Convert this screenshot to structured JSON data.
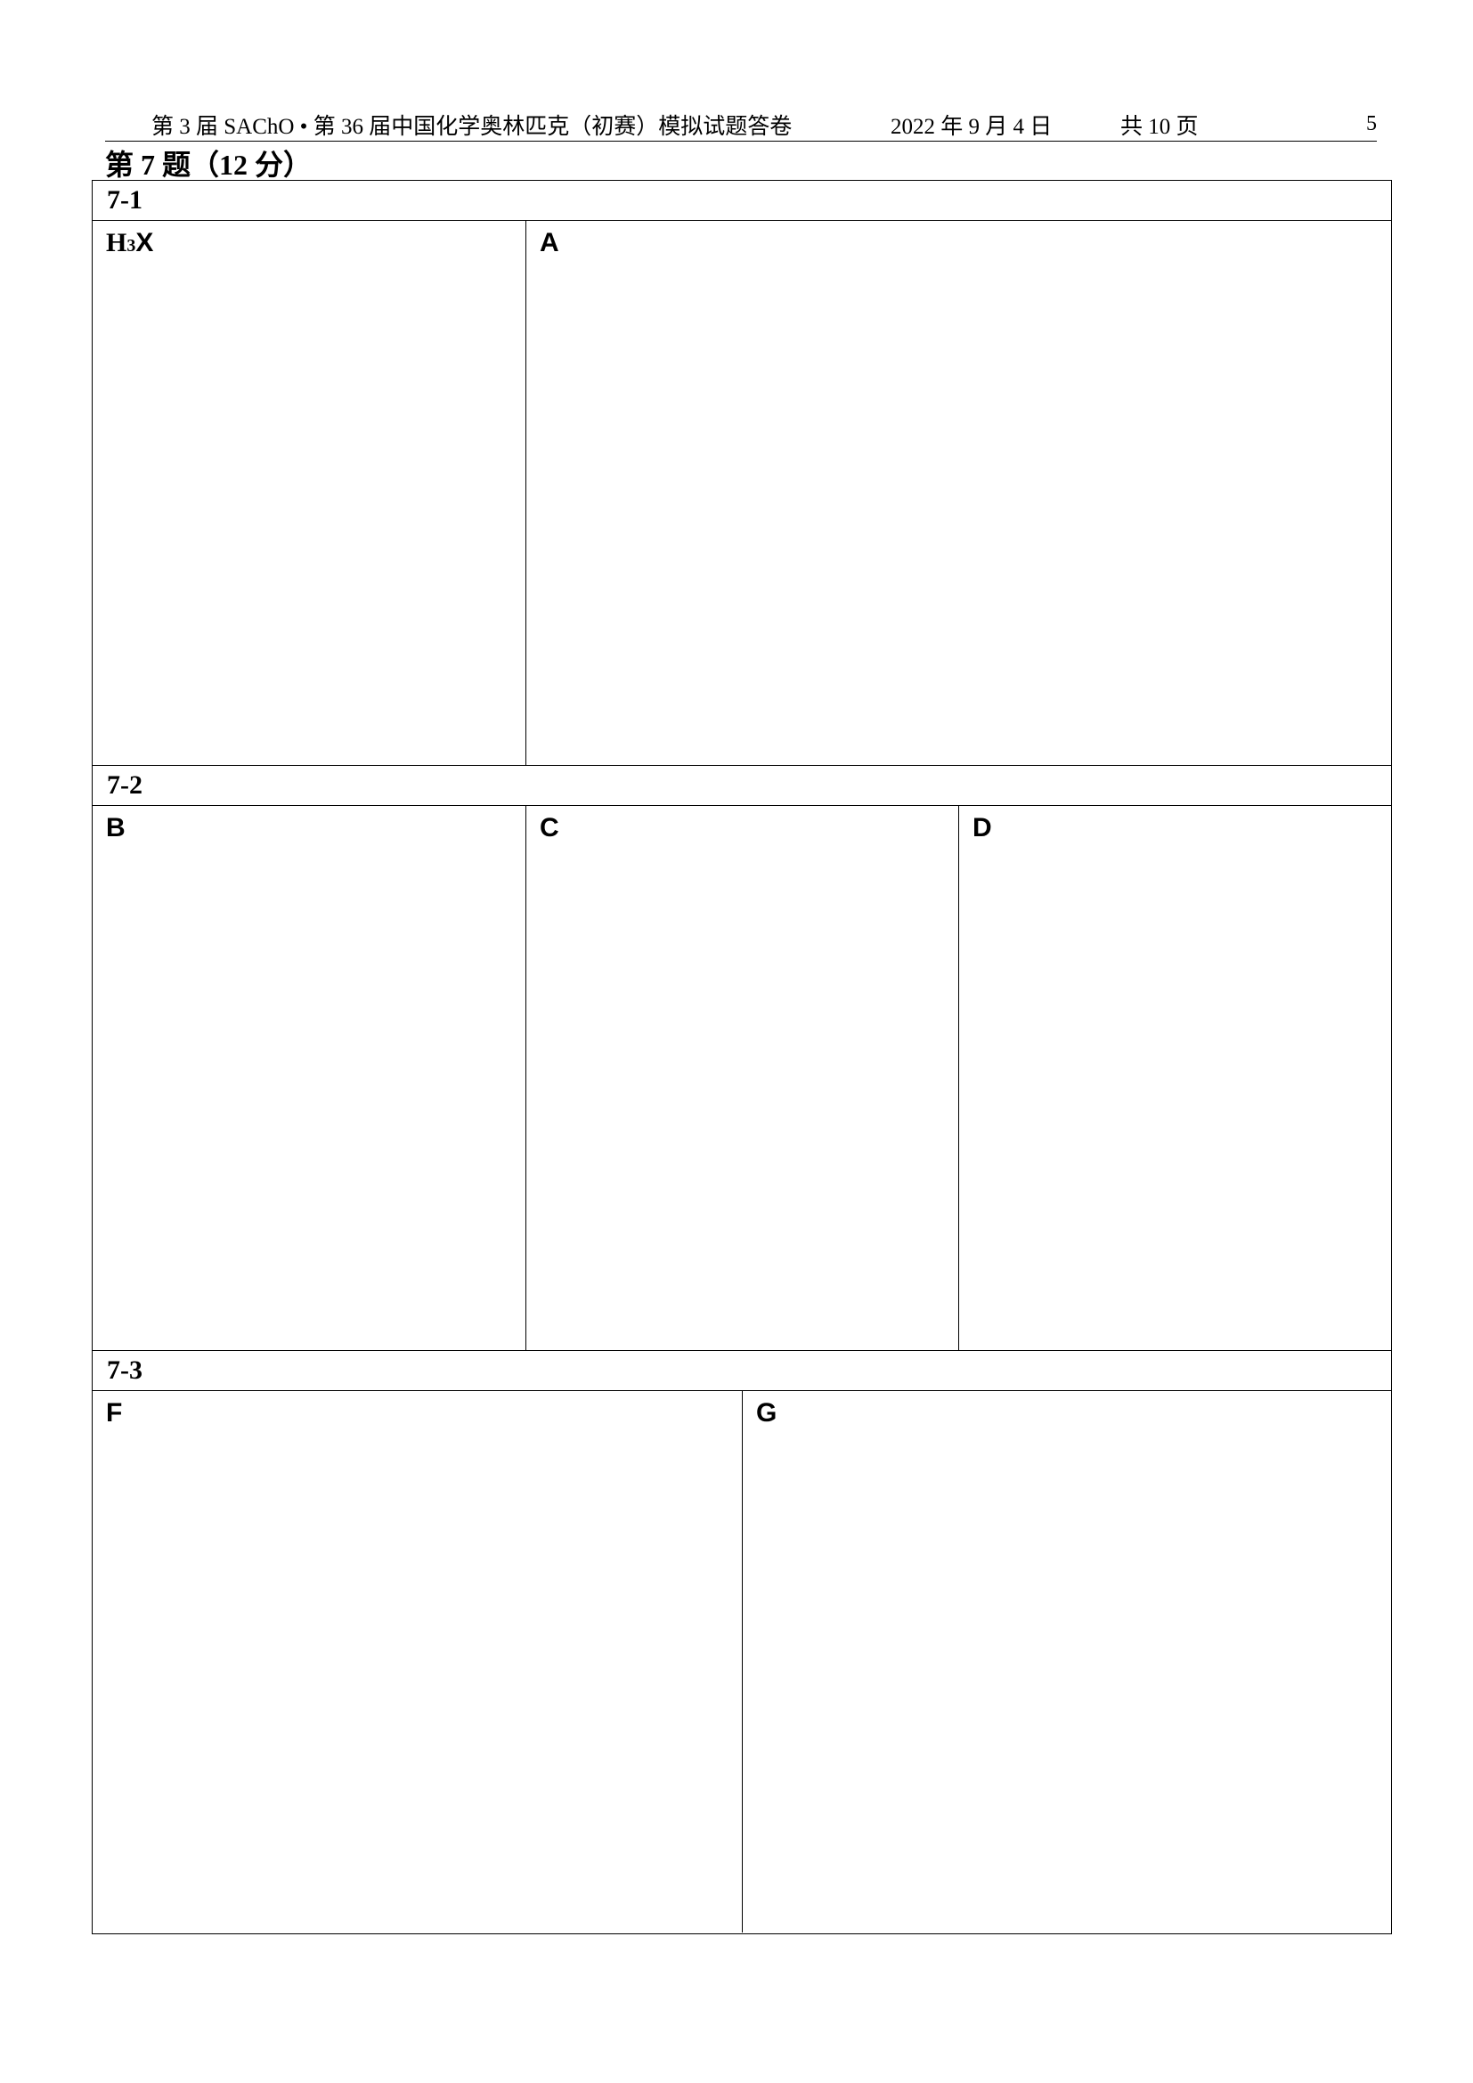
{
  "header": {
    "left_text": "第 3 届  SAChO   • 第 36 届中国化学奥林匹克（初赛）模拟试题答卷",
    "date": "2022 年 9 月 4 日",
    "total_pages": "共 10 页",
    "page_number": "5"
  },
  "question": {
    "title": "第 7 题（12 分）"
  },
  "sections": [
    {
      "label": "7-1",
      "boxes": [
        {
          "label_main": "H",
          "label_sub": "3",
          "label_tail": "X"
        },
        {
          "label": "A"
        }
      ]
    },
    {
      "label": "7-2",
      "boxes": [
        {
          "label": "B"
        },
        {
          "label": "C"
        },
        {
          "label": "D"
        }
      ]
    },
    {
      "label": "7-3",
      "boxes": [
        {
          "label": "F"
        },
        {
          "label": "G"
        }
      ]
    }
  ]
}
